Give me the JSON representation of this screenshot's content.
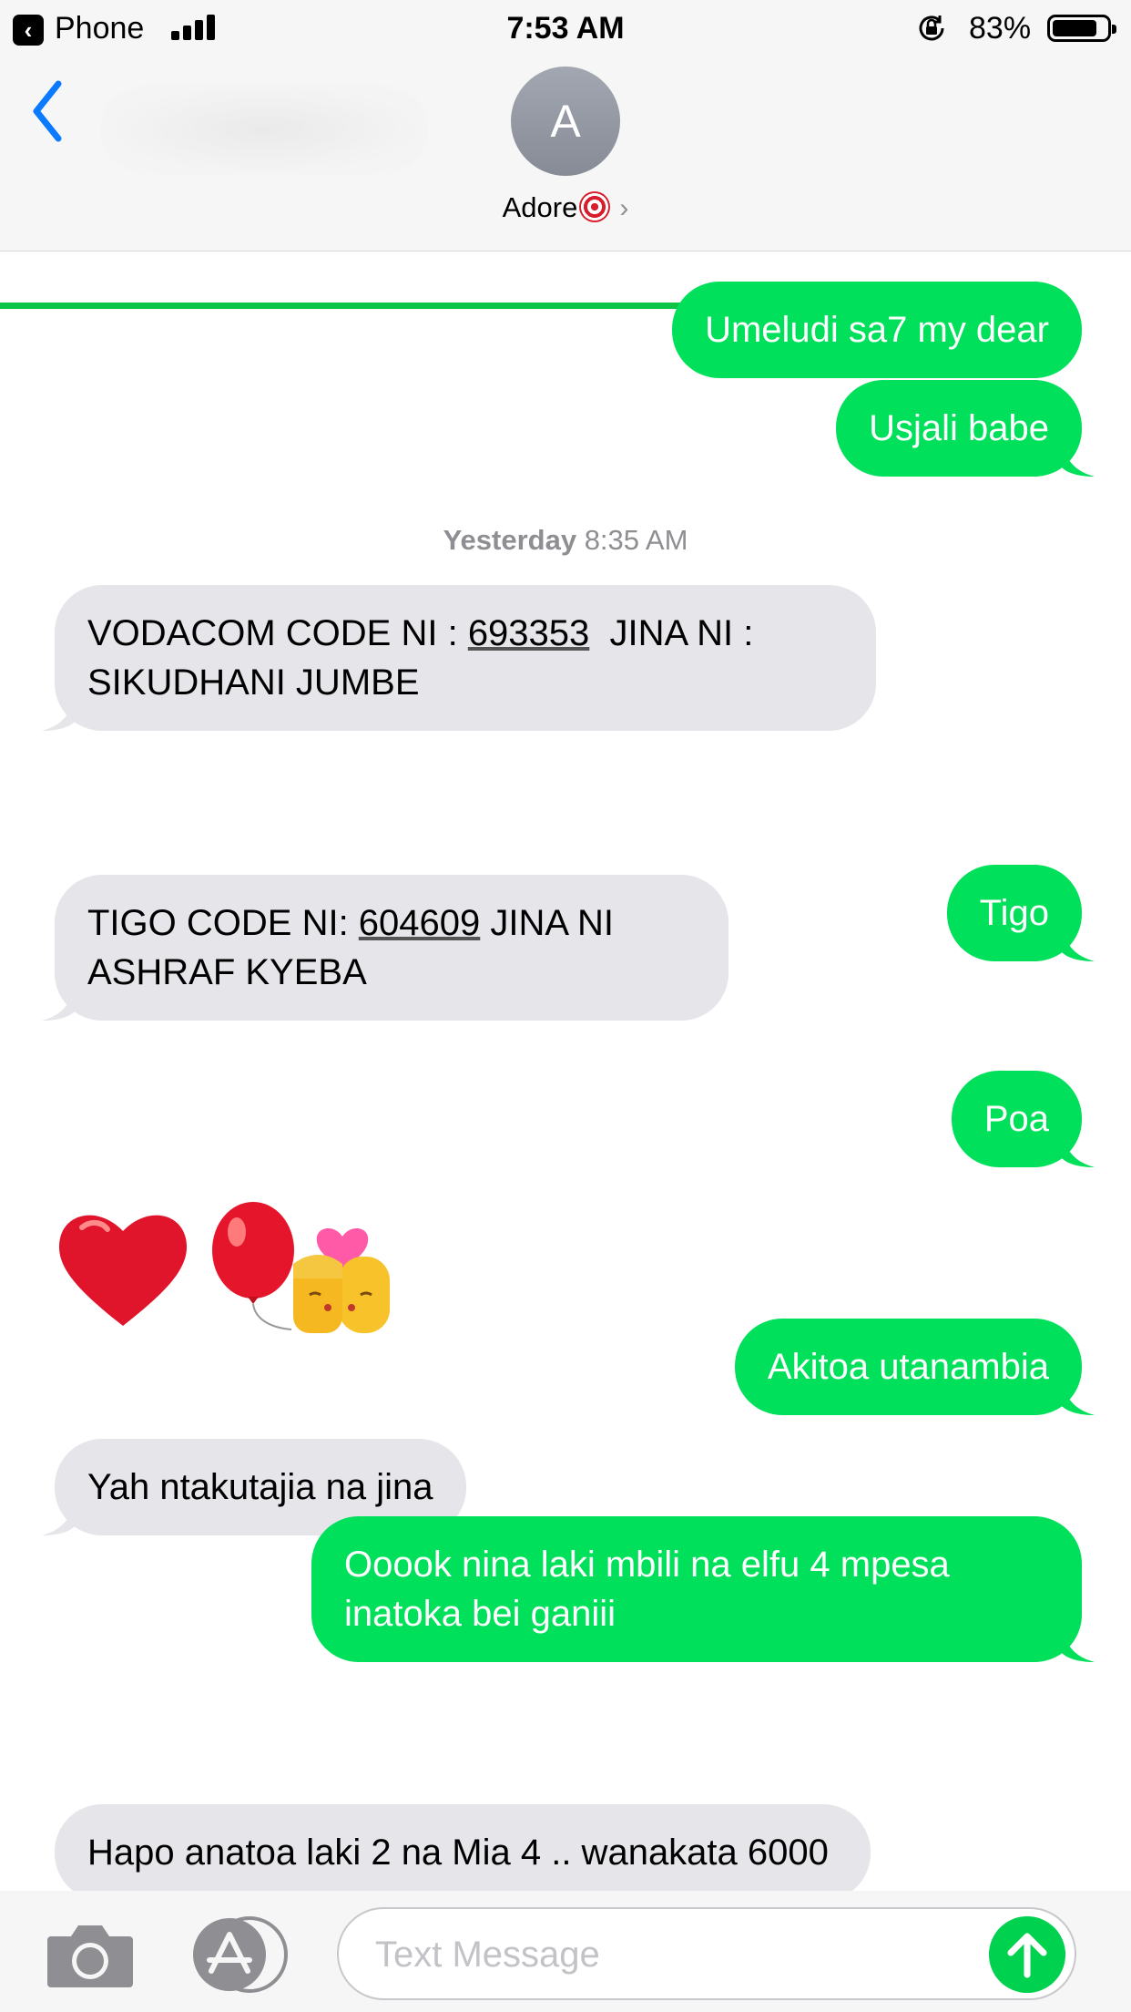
{
  "status_bar": {
    "back_app": "Phone",
    "time": "7:53 AM",
    "battery": "83%",
    "battery_level": 0.83
  },
  "header": {
    "avatar_initial": "A",
    "contact_name": "Adore",
    "contact_emoji": "dart-icon",
    "send_progress": 0.9
  },
  "messages": [
    {
      "dir": "out",
      "text": "Umeludi sa7 my dear"
    },
    {
      "dir": "out",
      "text": "Usjali babe"
    },
    {
      "timestamp_day": "Yesterday",
      "timestamp_time": "8:35 AM"
    },
    {
      "dir": "in",
      "text_1": "VODACOM CODE NI : ",
      "code": "693353",
      "text_2": "  JINA NI : SIKUDHANI JUMBE"
    },
    {
      "dir": "out",
      "text": "Tigo"
    },
    {
      "dir": "in",
      "text_1": "TIGO CODE NI: ",
      "code": "604609",
      "text_2": " JINA NI ASHRAF KYEBA"
    },
    {
      "dir": "out",
      "text": "Poa"
    },
    {
      "dir": "in",
      "emojis": [
        "red-heart-icon",
        "balloon-icon",
        "kiss-couple-icon"
      ]
    },
    {
      "dir": "out",
      "text": "Akitoa utanambia"
    },
    {
      "dir": "in",
      "text": "Yah ntakutajia na jina"
    },
    {
      "dir": "out",
      "text": "Ooook nina laki mbili na elfu 4 mpesa inatoka bei ganiii"
    },
    {
      "dir": "in",
      "text": "Hapo anatoa laki 2 na Mia 4 .. wanakata 6000"
    }
  ],
  "input": {
    "placeholder": "Text Message",
    "value": ""
  },
  "colors": {
    "outgoing": "#00e05a",
    "incoming": "#e5e5ea",
    "accent": "#0a7aff",
    "send": "#00d250"
  }
}
